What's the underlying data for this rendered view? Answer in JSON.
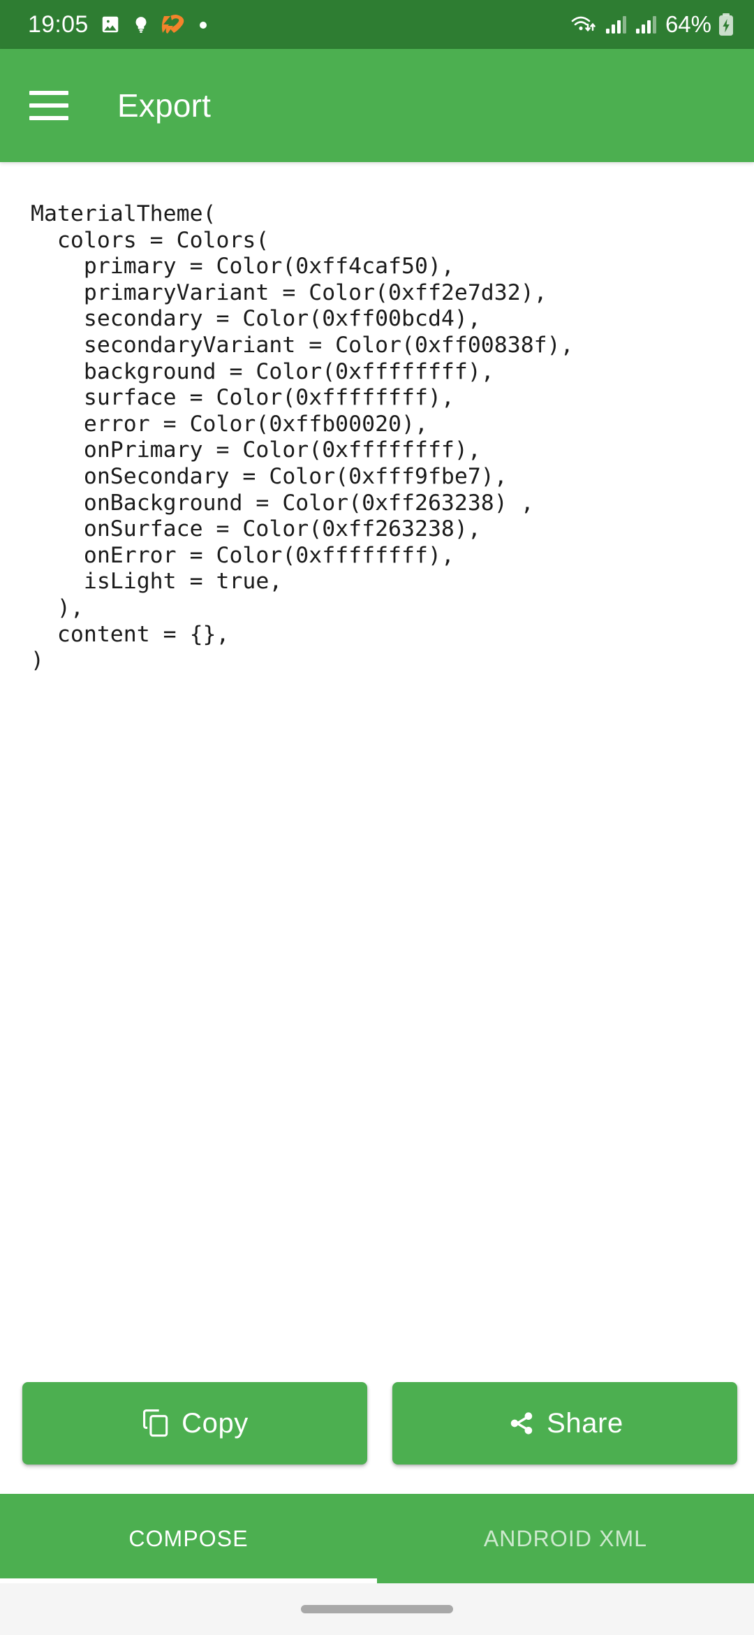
{
  "status_bar": {
    "time": "19:05",
    "battery_percent": "64%",
    "icons_left": [
      "photo-icon",
      "lightbulb-icon",
      "strava-heart-icon",
      "dot-icon"
    ],
    "icons_right": [
      "wifi-icon",
      "signal-bars-icon",
      "signal-bars-2-icon",
      "battery-charging-icon"
    ],
    "background_color": "#2e7d32"
  },
  "app_bar": {
    "title": "Export",
    "menu_icon": "hamburger-menu-icon",
    "background_color": "#4caf50"
  },
  "content": {
    "code": "MaterialTheme(\n  colors = Colors(\n    primary = Color(0xff4caf50),\n    primaryVariant = Color(0xff2e7d32),\n    secondary = Color(0xff00bcd4),\n    secondaryVariant = Color(0xff00838f),\n    background = Color(0xffffffff),\n    surface = Color(0xffffffff),\n    error = Color(0xffb00020),\n    onPrimary = Color(0xffffffff),\n    onSecondary = Color(0xfff9fbe7),\n    onBackground = Color(0xff263238) ,\n    onSurface = Color(0xff263238),\n    onError = Color(0xffffffff),\n    isLight = true,\n  ),\n  content = {},\n)"
  },
  "actions": {
    "copy_label": "Copy",
    "copy_icon": "content-copy-icon",
    "share_label": "Share",
    "share_icon": "share-icon",
    "button_color": "#4caf50"
  },
  "tabs": {
    "items": [
      {
        "label": "COMPOSE",
        "active": true
      },
      {
        "label": "ANDROID XML",
        "active": false
      }
    ],
    "indicator_color": "#ffffff",
    "background_color": "#4caf50"
  },
  "nav_bar": {
    "gesture_pill": "gesture-handle"
  }
}
